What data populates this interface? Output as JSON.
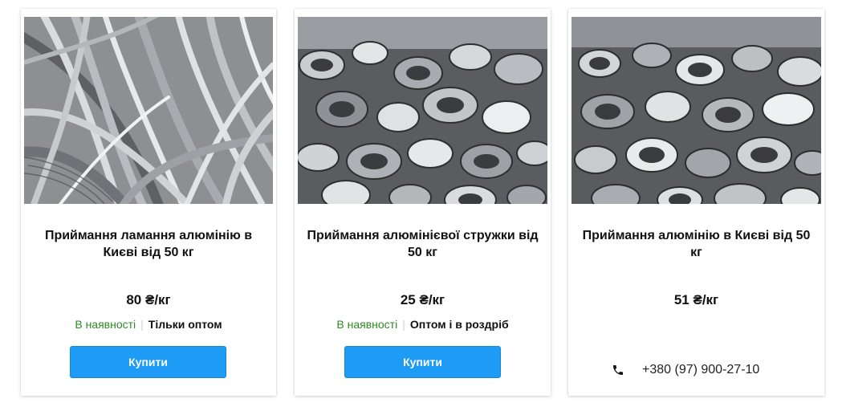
{
  "products": [
    {
      "title": "Приймання ламання алюмінію в Києві від 50 кг",
      "price": "80 ₴/кг",
      "availability": "В наявності",
      "sale_mode": "Тільки оптом",
      "buy_label": "Купити"
    },
    {
      "title": "Приймання алюмінієвої стружки від 50 кг",
      "price": "25 ₴/кг",
      "availability": "В наявності",
      "sale_mode": "Оптом і в роздріб",
      "buy_label": "Купити"
    },
    {
      "title": "Приймання алюмінію в Києві від 50 кг",
      "price": "51 ₴/кг",
      "phone": "+380 (97) 900-27-10"
    }
  ],
  "colors": {
    "accent": "#1e9bf5",
    "availability": "#2e8b23"
  },
  "icons": [
    "phone-icon"
  ]
}
